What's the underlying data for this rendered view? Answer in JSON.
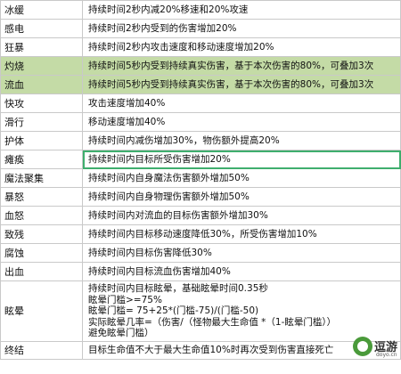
{
  "rows": [
    {
      "name": "冰缓",
      "desc": "持续时间2秒内减20%移速和20%攻速"
    },
    {
      "name": "感电",
      "desc": "持续时间2秒内受到的伤害增加20%"
    },
    {
      "name": "狂暴",
      "desc": "持续时间2秒内攻击速度和移动速度增加20%"
    },
    {
      "name": "灼烧",
      "desc": "持续时间5秒内受到持续真实伤害，基于本次伤害的80%，可叠加3次"
    },
    {
      "name": "流血",
      "desc": "持续时间5秒内受到持续真实伤害，基于本次伤害的80%，可叠加3次"
    },
    {
      "name": "快攻",
      "desc": "攻击速度增加40%"
    },
    {
      "name": "滑行",
      "desc": "移动速度增加40%"
    },
    {
      "name": "护体",
      "desc": "持续时间内减伤增加30%，物伤额外提高20%"
    },
    {
      "name": "瘫痪",
      "desc": "持续时间内目标所受伤害增加20%"
    },
    {
      "name": "魔法聚集",
      "desc": "持续时间内自身魔法伤害额外增加50%"
    },
    {
      "name": "暴怒",
      "desc": "持续时间内自身物理伤害额外增加50%"
    },
    {
      "name": "血怒",
      "desc": "持续时间内对流血的目标伤害额外增加30%"
    },
    {
      "name": "致残",
      "desc": "持续时间内目标移动速度降低30%，所受伤害增加10%"
    },
    {
      "name": "腐蚀",
      "desc": "持续时间内目标伤害降低30%"
    },
    {
      "name": "出血",
      "desc": "持续时间内目标流血伤害增加40%"
    }
  ],
  "stun": {
    "name": "眩晕",
    "lines": [
      "持续时间内目标眩晕，基础眩晕时间0.35秒",
      "眩晕门槛>=75%",
      "眩晕门槛= 75+25*(门槛-75)/(门槛-50)",
      "实际眩晕几率=（伤害/（怪物最大生命值 *（1-眩晕门槛））",
      "避免眩晕门槛）"
    ]
  },
  "final": {
    "name": "终结",
    "desc": "目标生命值不大于最大生命值10%时再次受到伤害直接死亡"
  },
  "watermark": {
    "text": "逗游",
    "sub": "doyo.cn"
  }
}
